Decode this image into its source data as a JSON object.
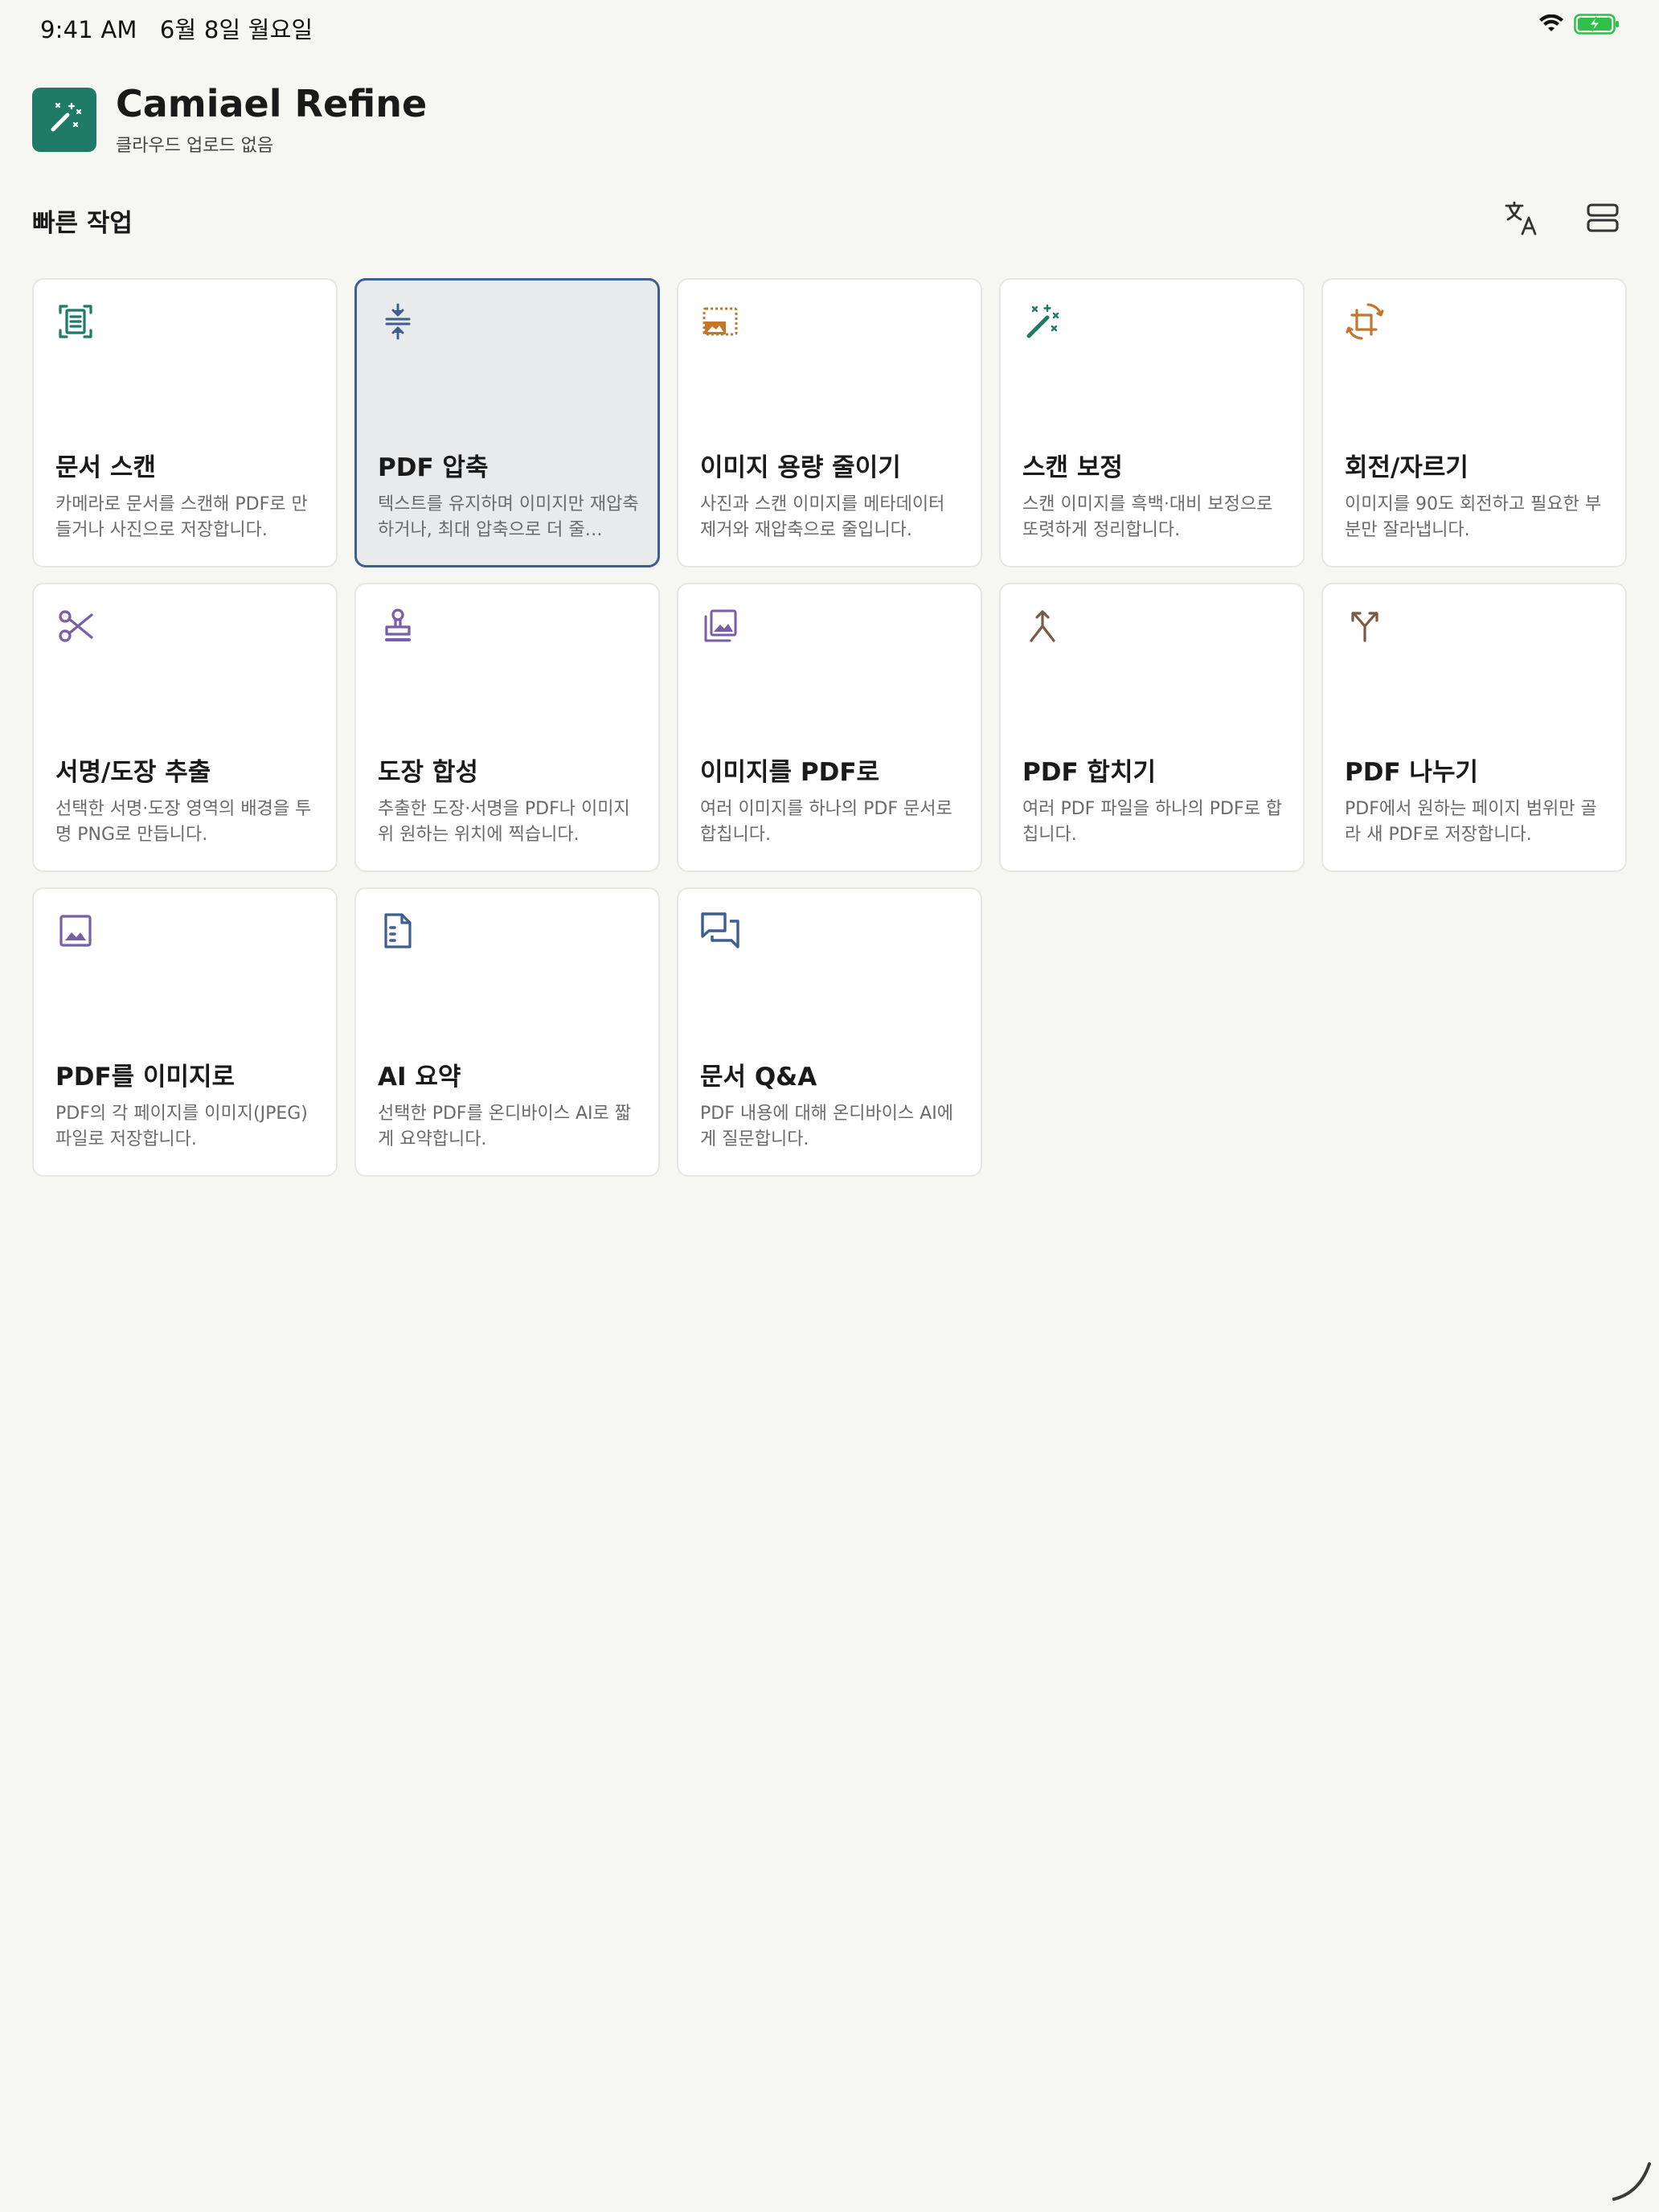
{
  "status_bar": {
    "time": "9:41 AM",
    "date": "6월 8일 월요일",
    "icons": [
      "wifi-icon",
      "battery-charging-icon"
    ]
  },
  "header": {
    "title": "Camiael Refine",
    "subtitle": "클라우드 업로드 없음",
    "logo_icon": "magic-wand-icon",
    "logo_color": "#1f7a68"
  },
  "section": {
    "title": "빠른 작업",
    "toolbar": [
      {
        "icon": "translate-icon"
      },
      {
        "icon": "layout-toggle-icon"
      }
    ]
  },
  "colors": {
    "green": "#1f7a68",
    "blue": "#3e5e8f",
    "orange": "#c4772b",
    "purple": "#7a5da7",
    "brown": "#7a5a45"
  },
  "cards": [
    {
      "title": "문서 스캔",
      "desc": "카메라로 문서를 스캔해 PDF로 만들거나 사진으로 저장합니다.",
      "icon": "document-scan-icon",
      "selected": false
    },
    {
      "title": "PDF 압축",
      "desc": "텍스트를 유지하며 이미지만 재압축하거나, 최대 압축으로 더 줄…",
      "icon": "compress-icon",
      "selected": true
    },
    {
      "title": "이미지 용량 줄이기",
      "desc": "사진과 스캔 이미지를 메타데이터 제거와 재압축으로 줄입니다.",
      "icon": "image-resize-icon",
      "selected": false
    },
    {
      "title": "스캔 보정",
      "desc": "스캔 이미지를 흑백·대비 보정으로 또렷하게 정리합니다.",
      "icon": "magic-wand-icon",
      "selected": false
    },
    {
      "title": "회전/자르기",
      "desc": "이미지를 90도 회전하고 필요한 부분만 잘라냅니다.",
      "icon": "crop-rotate-icon",
      "selected": false
    },
    {
      "title": "서명/도장 추출",
      "desc": "선택한 서명·도장 영역의 배경을 투명 PNG로 만듭니다.",
      "icon": "scissors-icon",
      "selected": false
    },
    {
      "title": "도장 합성",
      "desc": "추출한 도장·서명을 PDF나 이미지 위 원하는 위치에 찍습니다.",
      "icon": "stamp-icon",
      "selected": false
    },
    {
      "title": "이미지를 PDF로",
      "desc": "여러 이미지를 하나의 PDF 문서로 합칩니다.",
      "icon": "images-stack-icon",
      "selected": false
    },
    {
      "title": "PDF 합치기",
      "desc": "여러 PDF 파일을 하나의 PDF로 합칩니다.",
      "icon": "merge-icon",
      "selected": false
    },
    {
      "title": "PDF 나누기",
      "desc": "PDF에서 원하는 페이지 범위만 골라 새 PDF로 저장합니다.",
      "icon": "split-icon",
      "selected": false
    },
    {
      "title": "PDF를 이미지로",
      "desc": "PDF의 각 페이지를 이미지(JPEG) 파일로 저장합니다.",
      "icon": "image-icon",
      "selected": false
    },
    {
      "title": "AI 요약",
      "desc": "선택한 PDF를 온디바이스 AI로 짧게 요약합니다.",
      "icon": "document-summary-icon",
      "selected": false
    },
    {
      "title": "문서 Q&A",
      "desc": "PDF 내용에 대해 온디바이스 AI에게 질문합니다.",
      "icon": "chat-bubbles-icon",
      "selected": false
    }
  ]
}
